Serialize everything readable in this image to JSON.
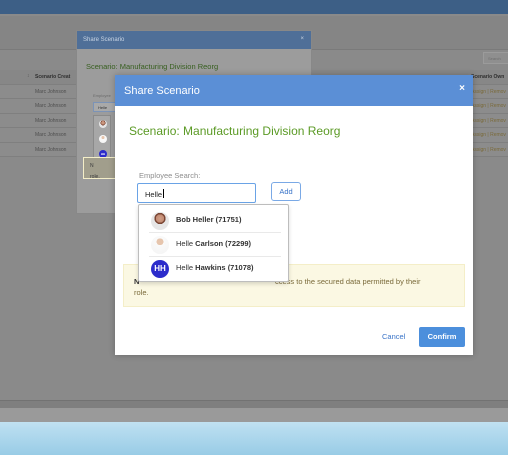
{
  "app": {
    "search_placeholder": "Search",
    "table": {
      "headers": [
        "Scenario Creat",
        "Scenario Own"
      ],
      "rows": [
        {
          "creator": "Marc Johnson",
          "owner": "Assign | Remov"
        },
        {
          "creator": "Marc Johnson",
          "owner": "Assign | Remov"
        },
        {
          "creator": "Marc Johnson",
          "owner": "Assign | Remov"
        },
        {
          "creator": "Marc Johnson",
          "owner": "Assign | Remov"
        },
        {
          "creator": "Marc Johnson",
          "owner": "Assign | Remov"
        }
      ]
    }
  },
  "background_dialog": {
    "header": "Share Scenario",
    "close": "×",
    "title": "Scenario: Manufacturing Division Reorg",
    "search_label": "Employee",
    "search_value": "Helle",
    "warning_prefix": "N",
    "warning_tail": "role."
  },
  "dialog": {
    "header": "Share Scenario",
    "close": "×",
    "title": "Scenario: Manufacturing Division Reorg",
    "search_label": "Employee Search:",
    "search_value": "Helle",
    "add_label": "Add",
    "warning_bold": "N",
    "warning_text": "ccess to the secured data permitted by their",
    "warning_line2": "role.",
    "cancel_label": "Cancel",
    "confirm_label": "Confirm"
  },
  "suggestions": [
    {
      "bold": "Bob Heller",
      "rest": " (71751)",
      "avatar": "photo"
    },
    {
      "bold": "Helle",
      "rest": " Carlson (72299)",
      "avatar": "photo"
    },
    {
      "bold": "Helle",
      "rest": " Hawkins (71078)",
      "avatar": "HH"
    }
  ],
  "colors": {
    "header_blue": "#5b8fd6",
    "title_green": "#5b9a25",
    "confirm_blue": "#4c8fdc",
    "warning_bg": "#fbf8e3",
    "initials_avatar": "#2c2ccb"
  }
}
